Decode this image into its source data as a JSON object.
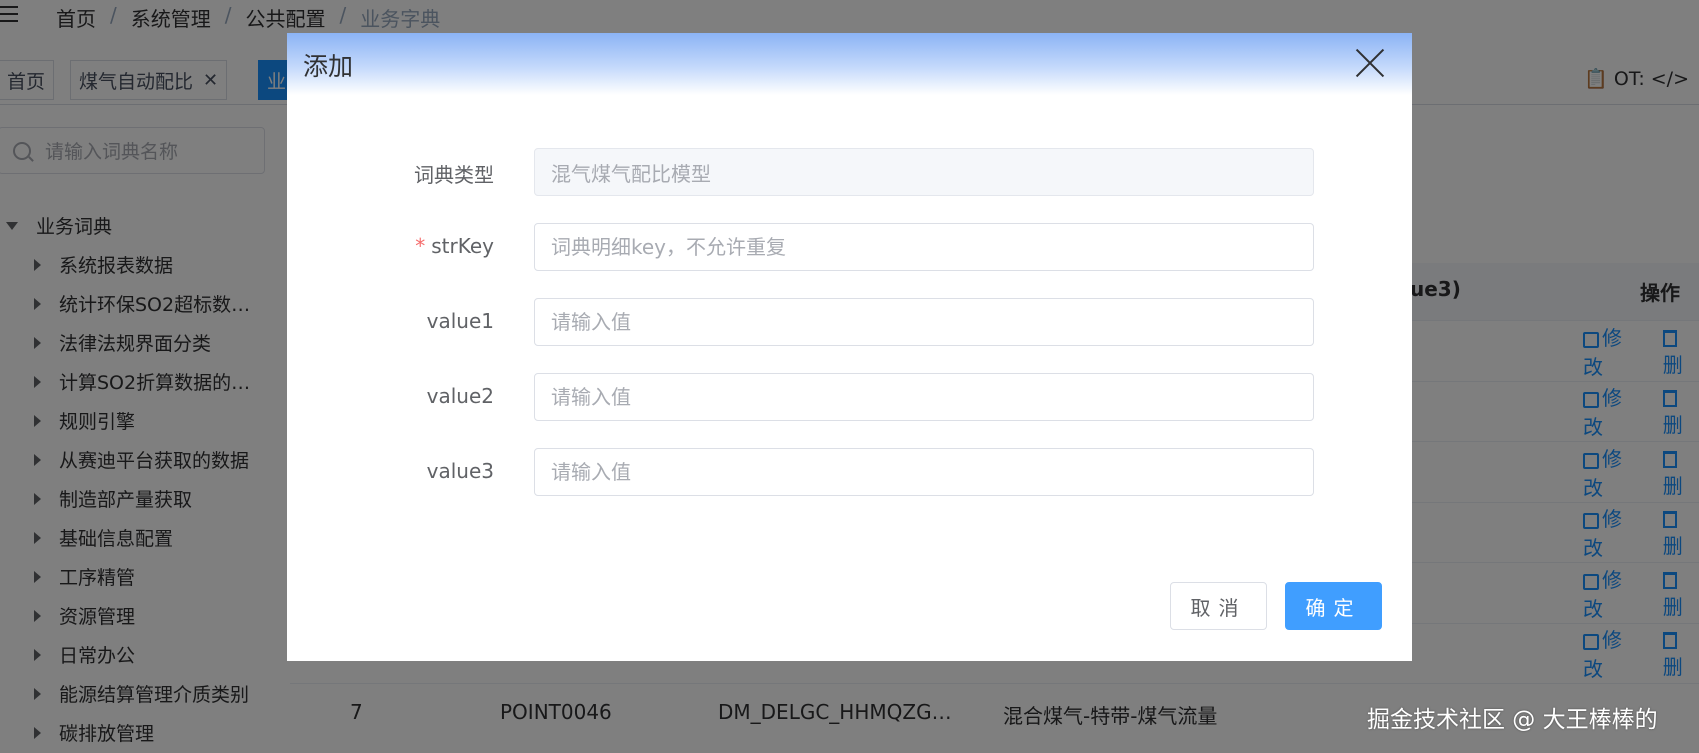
{
  "breadcrumb": [
    "首页",
    "系统管理",
    "公共配置",
    "业务字典"
  ],
  "tags": {
    "home": "首页",
    "gas": "煤气自动配比",
    "active_partial": "业"
  },
  "ot_label": "OT:",
  "sidebar": {
    "search_placeholder": "请输入词典名称",
    "root": "业务词典",
    "items": [
      "系统报表数据",
      "统计环保SO2超标数…",
      "法律法规界面分类",
      "计算SO2折算数据的…",
      "规则引擎",
      "从赛迪平台获取的数据",
      "制造部产量获取",
      "基础信息配置",
      "工序精管",
      "资源管理",
      "日常办公",
      "能源结算管理介质类别",
      "碳排放管理"
    ]
  },
  "table": {
    "header_value3_partial": "ue3)",
    "header_ops": "操作",
    "edit_label": "修改",
    "delete_label_partial": "删",
    "row7": {
      "index": "7",
      "code": "POINT0046",
      "key": "DM_DELGC_HHMQZG…",
      "name": "混合煤气-特带-煤气流量"
    }
  },
  "modal": {
    "title": "添加",
    "fields": {
      "dict_type": {
        "label": "词典类型",
        "value": "混气煤气配比模型"
      },
      "strkey": {
        "label": "strKey",
        "required_mark": "*",
        "placeholder": "词典明细key，不允许重复"
      },
      "value1": {
        "label": "value1",
        "placeholder": "请输入值"
      },
      "value2": {
        "label": "value2",
        "placeholder": "请输入值"
      },
      "value3": {
        "label": "value3",
        "placeholder": "请输入值"
      }
    },
    "cancel_label": "取消",
    "confirm_label": "确定"
  },
  "credit": "掘金技术社区 @ 大王棒棒的",
  "colors": {
    "primary": "#409eff",
    "required": "#f56c6c",
    "overlay": "rgba(0,0,0,0.5)"
  }
}
